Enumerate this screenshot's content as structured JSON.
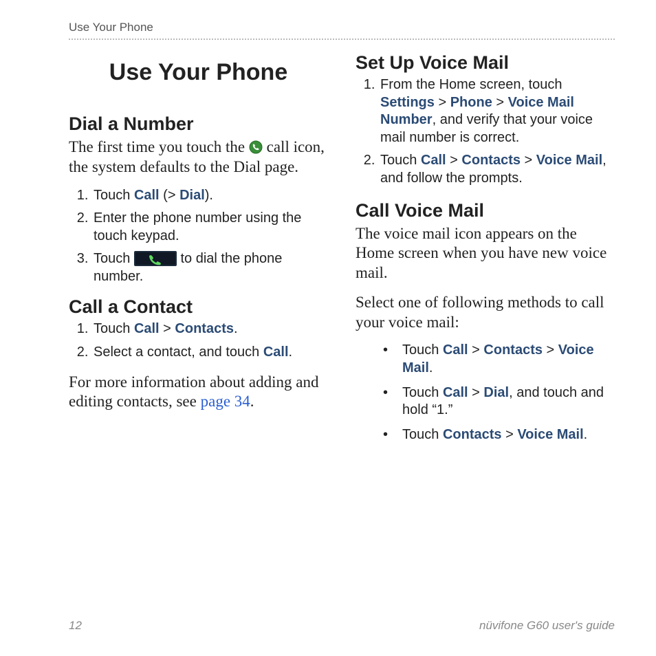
{
  "running_head": "Use Your Phone",
  "title": "Use Your Phone",
  "left": {
    "dial": {
      "heading": "Dial a Number",
      "intro_a": "The first time you touch the ",
      "intro_b": " call icon, the system defaults to the Dial page.",
      "steps": {
        "s1_a": "Touch ",
        "s1_call": "Call",
        "s1_b": " (> ",
        "s1_dial": "Dial",
        "s1_c": ").",
        "s2": "Enter the phone number using the touch keypad.",
        "s3_a": "Touch ",
        "s3_b": " to dial the phone number."
      }
    },
    "contact": {
      "heading": "Call a Contact",
      "s1_a": "Touch ",
      "s1_call": "Call",
      "s1_gt": " > ",
      "s1_contacts": "Contacts",
      "s1_dot": ".",
      "s2_a": "Select a contact, and touch ",
      "s2_call": "Call",
      "s2_dot": ".",
      "more_a": "For more information about adding and editing contacts, see ",
      "more_link": "page 34",
      "more_b": "."
    }
  },
  "right": {
    "setup": {
      "heading": "Set Up Voice Mail",
      "s1_a": "From the Home screen, touch ",
      "s1_settings": "Settings",
      "s1_gt1": " > ",
      "s1_phone": "Phone",
      "s1_gt2": " > ",
      "s1_vmn": "Voice Mail Number",
      "s1_b": ", and verify that your voice mail number is correct.",
      "s2_a": "Touch ",
      "s2_call": "Call",
      "s2_gt1": " > ",
      "s2_contacts": "Contacts",
      "s2_gt2": " > ",
      "s2_vm": "Voice Mail",
      "s2_b": ", and follow the prompts."
    },
    "callvm": {
      "heading": "Call Voice Mail",
      "p1": "The voice mail icon appears on the Home screen when you have new voice mail.",
      "p2": "Select one of following methods to call your voice mail:",
      "b1_a": "Touch ",
      "b1_call": "Call",
      "b1_gt1": " > ",
      "b1_contacts": "Contacts",
      "b1_gt2": " > ",
      "b1_vm": "Voice Mail",
      "b1_dot": ".",
      "b2_a": "Touch ",
      "b2_call": "Call",
      "b2_gt": " > ",
      "b2_dial": "Dial",
      "b2_b": ", and touch and hold “1.”",
      "b3_a": "Touch ",
      "b3_contacts": "Contacts",
      "b3_gt": " > ",
      "b3_vm": "Voice Mail",
      "b3_dot": "."
    }
  },
  "footer": {
    "page": "12",
    "guide": "nüvifone G60 user's guide"
  }
}
